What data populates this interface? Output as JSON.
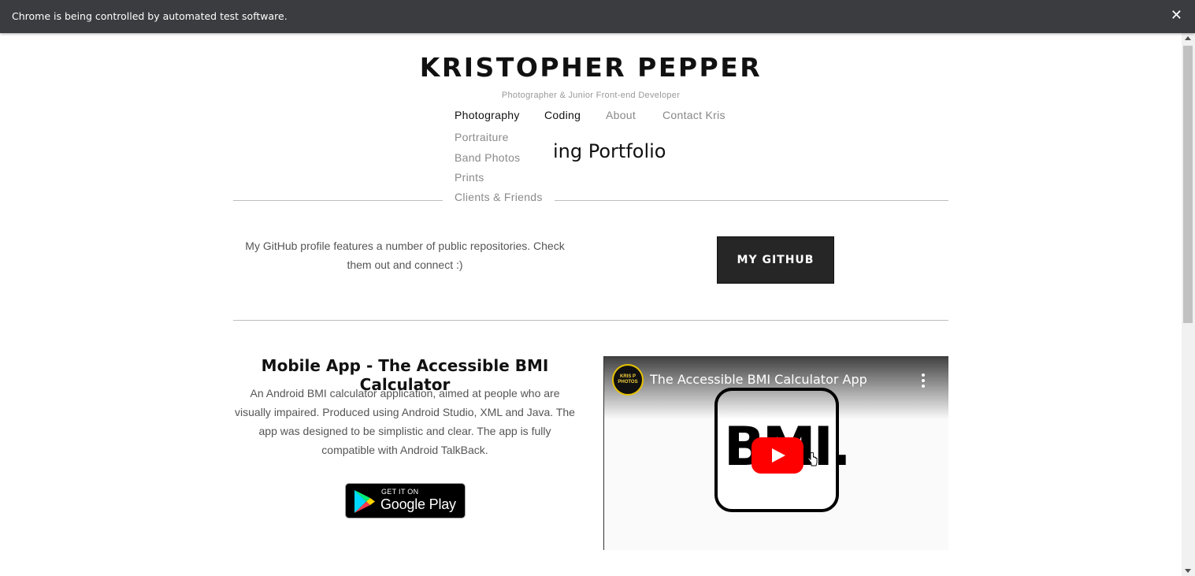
{
  "banner": {
    "message": "Chrome is being controlled by automated test software.",
    "close_glyph": "✕"
  },
  "site": {
    "title": "KRISTOPHER PEPPER",
    "tagline": "Photographer & Junior Front-end Developer"
  },
  "nav": {
    "items": [
      {
        "label": "Photography"
      },
      {
        "label": "Coding"
      },
      {
        "label": "About"
      },
      {
        "label": "Contact Kris"
      }
    ],
    "photography_submenu": [
      {
        "label": "Portraiture"
      },
      {
        "label": "Band Photos"
      },
      {
        "label": "Prints"
      },
      {
        "label": "Clients & Friends"
      }
    ]
  },
  "page": {
    "heading_visible": "ing Portfolio"
  },
  "github": {
    "text": "My GitHub profile features a number of public repositories. Check them out and connect :)",
    "button_label": "MY GITHUB"
  },
  "app": {
    "title": "Mobile App - The Accessible BMI Calculator",
    "description": "An Android BMI calculator application, aimed at people who are visually impaired. Produced using Android Studio, XML and Java. The app was designed to be simplistic and clear. The app is fully compatible with Android TalkBack.",
    "badge_small": "GET IT ON",
    "badge_big": "Google Play"
  },
  "video": {
    "title": "The Accessible BMI Calculator App",
    "channel_avatar_text": "KRIS P PHOTOS",
    "thumbnail_text": "BMI."
  },
  "colors": {
    "banner_bg": "#3b3c3f",
    "button_bg": "#262626",
    "youtube_red": "#ff0000"
  }
}
